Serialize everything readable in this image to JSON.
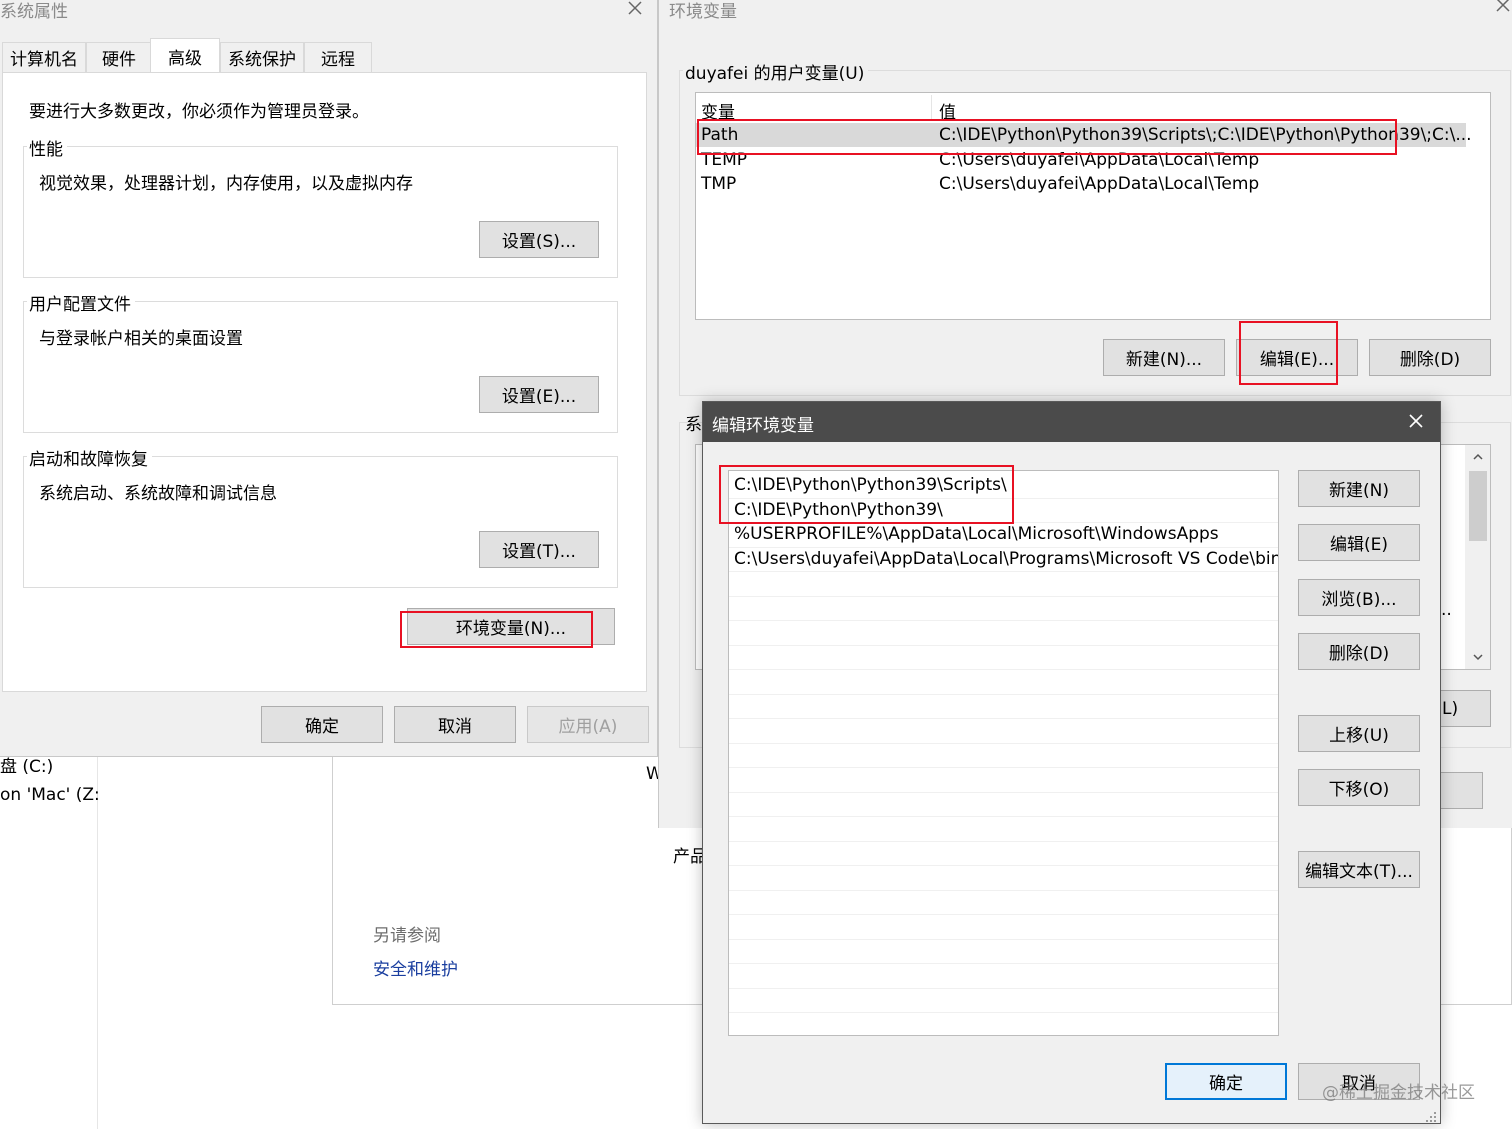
{
  "sys_props": {
    "title": "系统属性",
    "tabs": [
      "计算机名",
      "硬件",
      "高级",
      "系统保护",
      "远程"
    ],
    "admin_note": "要进行大多数更改，你必须作为管理员登录。",
    "performance": {
      "label": "性能",
      "desc": "视觉效果，处理器计划，内存使用，以及虚拟内存",
      "button": "设置(S)..."
    },
    "profiles": {
      "label": "用户配置文件",
      "desc": "与登录帐户相关的桌面设置",
      "button": "设置(E)..."
    },
    "startup": {
      "label": "启动和故障恢复",
      "desc": "系统启动、系统故障和调试信息",
      "button": "设置(T)..."
    },
    "env_button": "环境变量(N)...",
    "ok": "确定",
    "cancel": "取消",
    "apply": "应用(A)"
  },
  "background": {
    "drive_c": "盘 (C:)",
    "drive_z": "on 'Mac' (Z:",
    "w_char": "W",
    "product_text": "产品",
    "see_also": "另请参阅",
    "security_link": "安全和维护"
  },
  "env_vars": {
    "title": "环境变量",
    "user_section": "duyafei 的用户变量(U)",
    "columns": [
      "变量",
      "值"
    ],
    "user_vars": [
      {
        "name": "Path",
        "value": "C:\\IDE\\Python\\Python39\\Scripts\\;C:\\IDE\\Python\\Python39\\;C:\\..."
      },
      {
        "name": "TEMP",
        "value": "C:\\Users\\duyafei\\AppData\\Local\\Temp"
      },
      {
        "name": "TMP",
        "value": "C:\\Users\\duyafei\\AppData\\Local\\Temp"
      }
    ],
    "new_button": "新建(N)...",
    "edit_button": "编辑(E)...",
    "delete_button": "删除(D)",
    "system_section_partial": "系",
    "partial_button": "L)",
    "ellipsis": ".."
  },
  "edit_env": {
    "title": "编辑环境变量",
    "paths": [
      "C:\\IDE\\Python\\Python39\\Scripts\\",
      "C:\\IDE\\Python\\Python39\\",
      "%USERPROFILE%\\AppData\\Local\\Microsoft\\WindowsApps",
      "C:\\Users\\duyafei\\AppData\\Local\\Programs\\Microsoft VS Code\\bin"
    ],
    "buttons": {
      "new": "新建(N)",
      "edit": "编辑(E)",
      "browse": "浏览(B)...",
      "delete": "删除(D)",
      "move_up": "上移(U)",
      "move_down": "下移(O)",
      "edit_text": "编辑文本(T)..."
    },
    "ok": "确定",
    "cancel": "取消"
  },
  "watermark": "@稀土掘金技术社区",
  "icons": {
    "close": "close-icon",
    "scroll_up": "chevron-up-icon",
    "scroll_down": "chevron-down-icon",
    "grip": "resize-grip-icon"
  }
}
